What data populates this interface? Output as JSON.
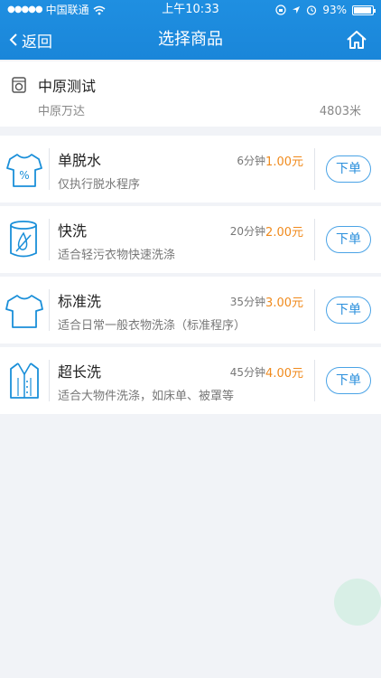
{
  "status_bar": {
    "carrier": "中国联通",
    "time": "上午10:33",
    "battery": "93%"
  },
  "nav": {
    "back_label": "返回",
    "title": "选择商品"
  },
  "store": {
    "name": "中原测试",
    "address": "中原万达",
    "distance": "4803米"
  },
  "products": [
    {
      "name": "单脱水",
      "desc": "仅执行脱水程序",
      "time": "6分钟",
      "price": "1.00元",
      "button": "下单",
      "icon": "tshirt-percent-icon"
    },
    {
      "name": "快洗",
      "desc": "适合轻污衣物快速洗涤",
      "time": "20分钟",
      "price": "2.00元",
      "button": "下单",
      "icon": "drum-drop-icon"
    },
    {
      "name": "标准洗",
      "desc": "适合日常一般衣物洗涤（标准程序）",
      "time": "35分钟",
      "price": "3.00元",
      "button": "下单",
      "icon": "tshirt-icon"
    },
    {
      "name": "超长洗",
      "desc": "适合大物件洗涤，如床单、被罩等",
      "time": "45分钟",
      "price": "4.00元",
      "button": "下单",
      "icon": "coat-icon"
    }
  ],
  "colors": {
    "header": "#1f8fe1",
    "price": "#f08a1c",
    "accent": "#2a8fdc"
  }
}
